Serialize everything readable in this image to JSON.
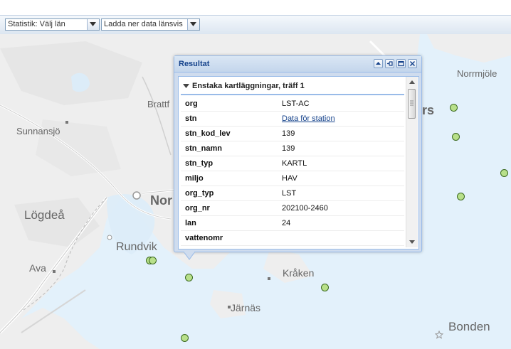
{
  "toolbar": {
    "statistik_combo": "Statistik: Välj län",
    "ladda_combo": "Ladda ner data länsvis"
  },
  "map": {
    "places": {
      "normjole": "Norrmjöle",
      "brattf": "Brattf",
      "sunnansjo": "Sunnansjö",
      "logdea": "Lögdeå",
      "nor": "Nor",
      "rundvik": "Rundvik",
      "ava": "Ava",
      "kraken": "Kråken",
      "jarnas": "Järnäs",
      "bonden": "Bonden",
      "rs": "rs"
    }
  },
  "popup": {
    "title": "Resultat",
    "group_title": "Enstaka kartläggningar, träff 1",
    "rows": [
      {
        "key": "org",
        "value": "LST-AC"
      },
      {
        "key": "stn",
        "value": "Data för station"
      },
      {
        "key": "stn_kod_lev",
        "value": "139"
      },
      {
        "key": "stn_namn",
        "value": "139"
      },
      {
        "key": "stn_typ",
        "value": "KARTL"
      },
      {
        "key": "miljo",
        "value": "HAV"
      },
      {
        "key": "org_typ",
        "value": "LST"
      },
      {
        "key": "org_nr",
        "value": "202100-2460"
      },
      {
        "key": "lan",
        "value": "24"
      },
      {
        "key": "vattenomr",
        "value": ""
      }
    ]
  }
}
